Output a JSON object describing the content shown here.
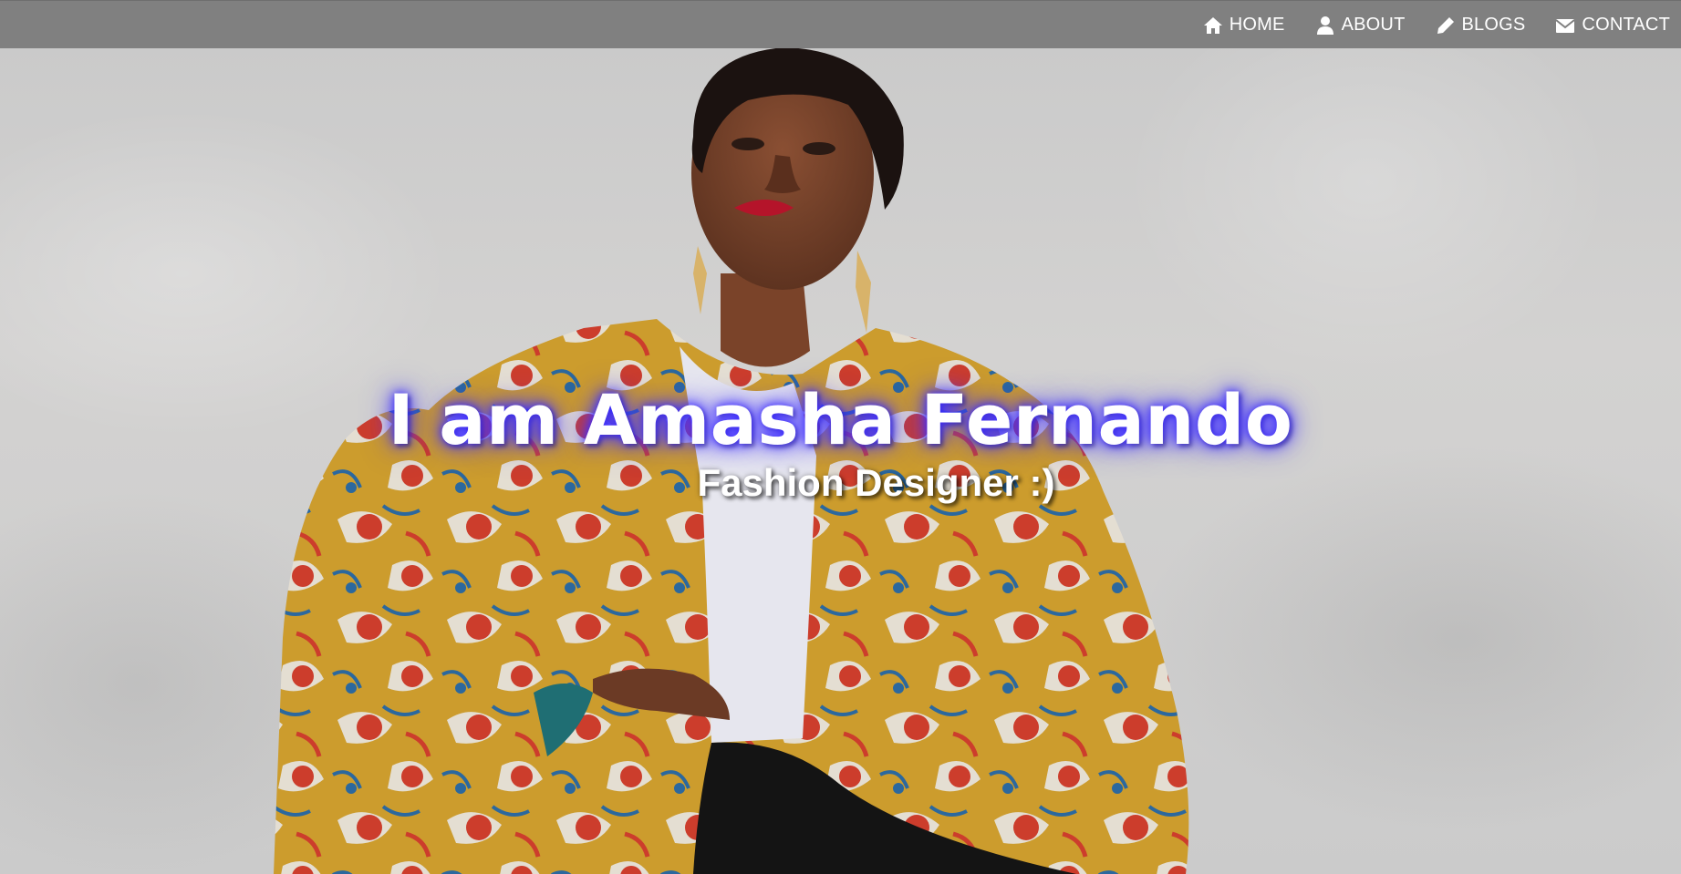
{
  "nav": {
    "items": [
      {
        "label": "HOME",
        "icon": "home-icon"
      },
      {
        "label": "ABOUT",
        "icon": "user-icon"
      },
      {
        "label": "BLOGS",
        "icon": "pencil-icon"
      },
      {
        "label": "CONTACT",
        "icon": "envelope-icon"
      }
    ]
  },
  "hero": {
    "title": "I am Amasha Fernando",
    "subtitle": "Fashion Designer :)"
  },
  "colors": {
    "navbar": "#808080",
    "title_glow": "#3b2aff",
    "jacket": "#d9a630",
    "jacket_accent": "#d9412f",
    "jacket_pattern": "#2e6fa8"
  }
}
